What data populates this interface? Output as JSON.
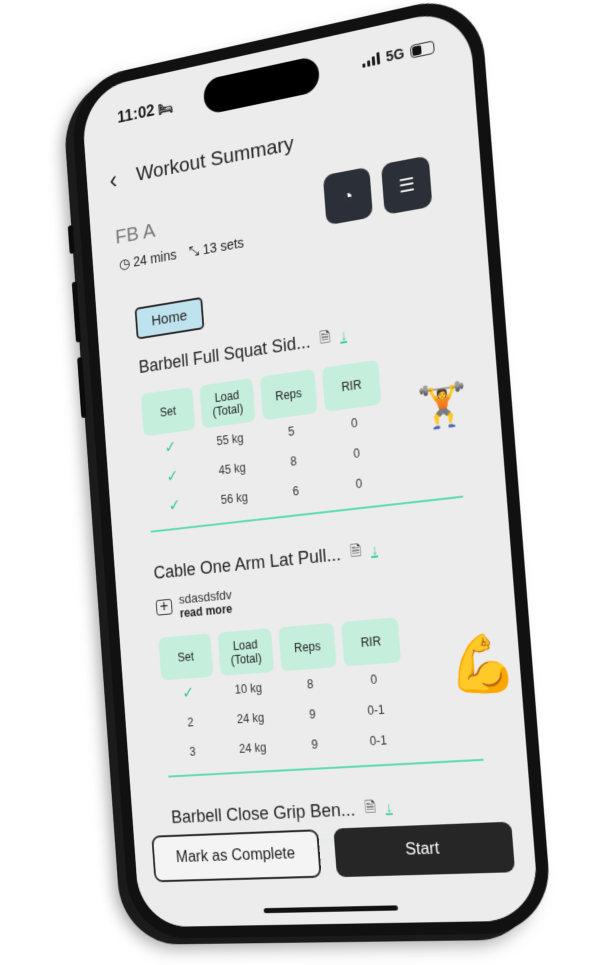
{
  "status_bar": {
    "time": "11:02",
    "focus_icon": "bed-icon",
    "network": "5G"
  },
  "header": {
    "back_icon": "chevron-left-icon",
    "title": "Workout Summary"
  },
  "workout": {
    "name": "FB A",
    "duration": "24 mins",
    "sets": "13 sets",
    "tag": "Home"
  },
  "actions": {
    "timer_icon": "gauge-icon",
    "settings_icon": "sliders-icon"
  },
  "exercises": [
    {
      "title": "Barbell Full Squat Sid...",
      "headers": [
        "Set",
        "Load\n(Total)",
        "Reps",
        "RIR"
      ],
      "rows": [
        {
          "set": "✓",
          "done": true,
          "load": "55 kg",
          "reps": "5",
          "rir": "0"
        },
        {
          "set": "✓",
          "done": true,
          "load": "45 kg",
          "reps": "8",
          "rir": "0"
        },
        {
          "set": "✓",
          "done": true,
          "load": "56 kg",
          "reps": "6",
          "rir": "0"
        }
      ]
    },
    {
      "title": "Cable One Arm Lat Pull...",
      "note": "sdasdsfdv",
      "read_more": "read more",
      "headers": [
        "Set",
        "Load\n(Total)",
        "Reps",
        "RIR"
      ],
      "rows": [
        {
          "set": "✓",
          "done": true,
          "load": "10 kg",
          "reps": "8",
          "rir": "0"
        },
        {
          "set": "2",
          "done": false,
          "load": "24 kg",
          "reps": "9",
          "rir": "0-1"
        },
        {
          "set": "3",
          "done": false,
          "load": "24 kg",
          "reps": "9",
          "rir": "0-1"
        }
      ]
    },
    {
      "title": "Barbell Close Grip Ben..."
    }
  ],
  "buttons": {
    "mark_complete": "Mark as Complete",
    "start": "Start"
  }
}
